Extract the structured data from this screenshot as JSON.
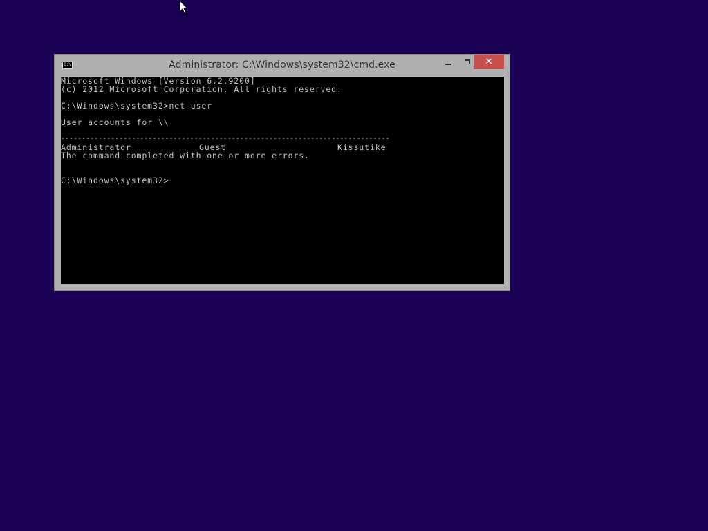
{
  "desktop": {
    "background": "#1a0052"
  },
  "window": {
    "title": "Administrator: C:\\Windows\\system32\\cmd.exe",
    "icon_label": "C:\\",
    "controls": {
      "minimize": "minimize-icon",
      "maximize": "maximize-icon",
      "close": "close-icon",
      "close_color": "#c7504d"
    }
  },
  "console": {
    "lines": [
      "Microsoft Windows [Version 6.2.9200]",
      "(c) 2012 Microsoft Corporation. All rights reserved.",
      "C:\\Windows\\system32>net user",
      "User accounts for \\\\",
      "The command completed with one or more errors.",
      "C:\\Windows\\system32>"
    ],
    "separator": "-------------------------------------------------------------------------------",
    "accounts": [
      "Administrator",
      "Guest",
      "Kissutike"
    ]
  }
}
